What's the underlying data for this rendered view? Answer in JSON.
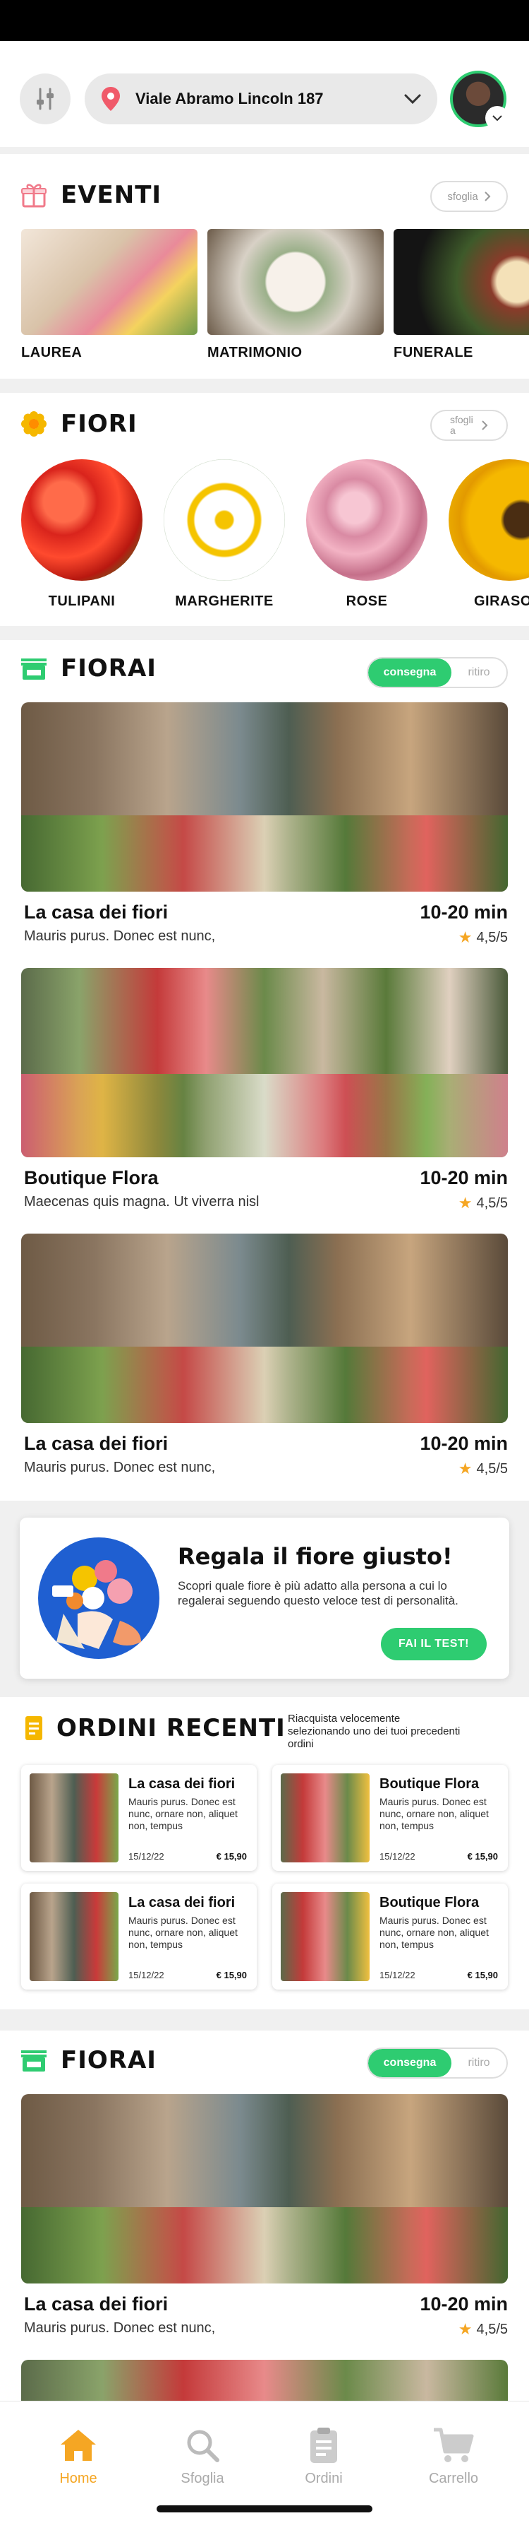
{
  "header": {
    "address": "Viale Abramo Lincoln 187"
  },
  "eventi": {
    "title": "EVENTI",
    "browse_label": "sfoglia",
    "items": [
      {
        "label": "LAUREA"
      },
      {
        "label": "MATRIMONIO"
      },
      {
        "label": "FUNERALE"
      }
    ]
  },
  "fiori": {
    "title": "FIORI",
    "browse_label": "sfogli a",
    "items": [
      {
        "label": "TULIPANI"
      },
      {
        "label": "MARGHERITE"
      },
      {
        "label": "ROSE"
      },
      {
        "label": "GIRASO"
      }
    ]
  },
  "fiorai": {
    "title": "FIORAI",
    "toggle_on": "consegna",
    "toggle_off": "ritiro",
    "shops": [
      {
        "name": "La casa dei fiori",
        "desc": "Mauris purus. Donec est nunc,",
        "time": "10-20 min",
        "rating": "4,5/5"
      },
      {
        "name": "Boutique Flora",
        "desc": "Maecenas quis magna. Ut viverra nisl",
        "time": "10-20 min",
        "rating": "4,5/5"
      },
      {
        "name": "La casa dei fiori",
        "desc": "Mauris purus. Donec est nunc,",
        "time": "10-20 min",
        "rating": "4,5/5"
      }
    ]
  },
  "promo": {
    "title": "Regala il fiore giusto!",
    "text": "Scopri quale fiore è più adatto alla persona a cui lo regalerai seguendo questo veloce test di personalità.",
    "cta": "FAI IL TEST!"
  },
  "ordini": {
    "title": "ORDINI RECENTI",
    "subtitle": "Riacquista velocemente selezionando uno dei tuoi precedenti ordini",
    "items": [
      {
        "name": "La casa dei fiori",
        "desc": "Mauris purus. Donec est nunc, ornare non, aliquet non, tempus",
        "date": "15/12/22",
        "price": "€ 15,90"
      },
      {
        "name": "Boutique Flora",
        "desc": "Mauris purus. Donec est nunc, ornare non, aliquet non, tempus",
        "date": "15/12/22",
        "price": "€ 15,90"
      },
      {
        "name": "La casa dei fiori",
        "desc": "Mauris purus. Donec est nunc, ornare non, aliquet non, tempus",
        "date": "15/12/22",
        "price": "€ 15,90"
      },
      {
        "name": "Boutique Flora",
        "desc": "Mauris purus. Donec est nunc, ornare non, aliquet non, tempus",
        "date": "15/12/22",
        "price": "€ 15,90"
      }
    ]
  },
  "fiorai2": {
    "title": "FIORAI",
    "toggle_on": "consegna",
    "toggle_off": "ritiro",
    "shops": [
      {
        "name": "La casa dei fiori",
        "desc": "Mauris purus. Donec est nunc,",
        "time": "10-20 min",
        "rating": "4,5/5"
      }
    ]
  },
  "tabbar": {
    "items": [
      {
        "label": "Home",
        "icon": "home-icon",
        "active": true
      },
      {
        "label": "Sfoglia",
        "icon": "search-icon",
        "active": false
      },
      {
        "label": "Ordini",
        "icon": "clipboard-icon",
        "active": false
      },
      {
        "label": "Carrello",
        "icon": "cart-icon",
        "active": false
      }
    ]
  },
  "colors": {
    "accent_green": "#2ecc71",
    "accent_orange": "#f5a623",
    "pin_red": "#f05a6a"
  }
}
